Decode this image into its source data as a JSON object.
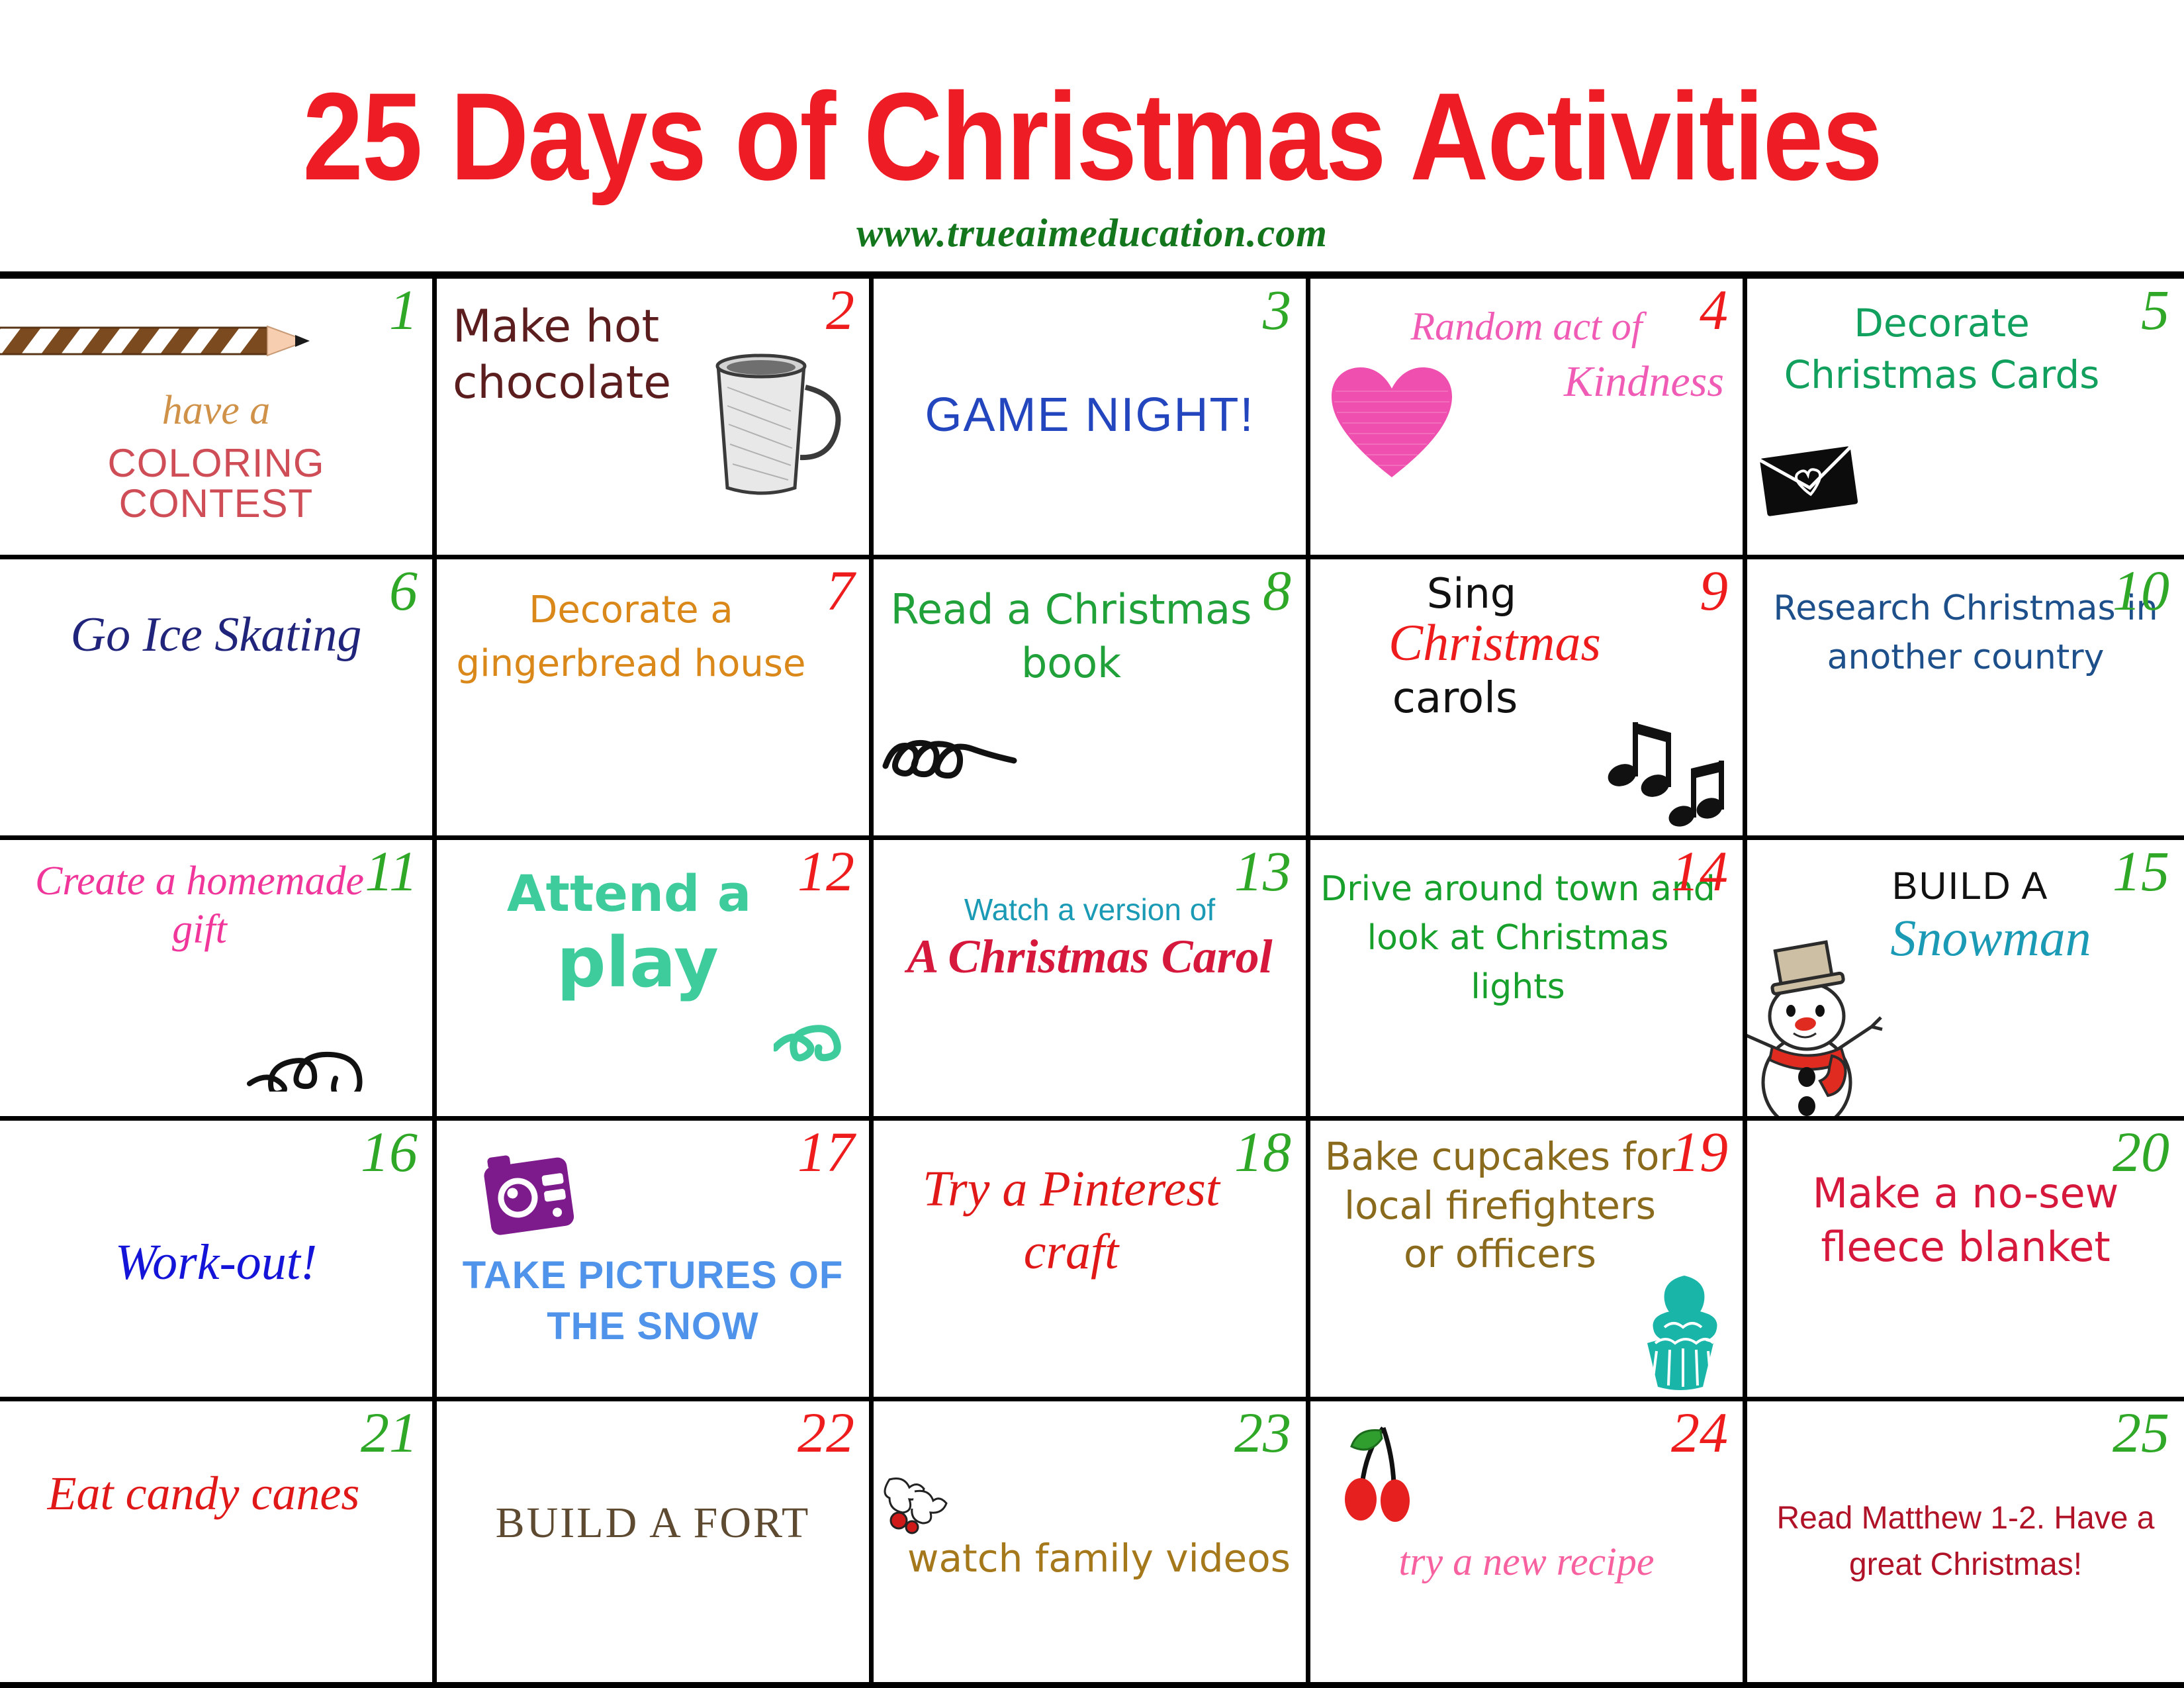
{
  "header": {
    "title": "25 Days of Christmas Activities",
    "website": "www.trueaimeducation.com"
  },
  "colors": {
    "title_red": "#ee1c25",
    "website_green": "#13761c",
    "number_green": "#2fa828",
    "number_red": "#ee1c1c",
    "grid_line": "#000000",
    "background": "#ffffff"
  },
  "grid": {
    "columns": 5,
    "rows": 5
  },
  "days": [
    {
      "num": "1",
      "num_color": "green",
      "lines": [
        "have a",
        "COLORING CONTEST"
      ],
      "icons": [
        "pencil-icon"
      ]
    },
    {
      "num": "2",
      "num_color": "red",
      "lines": [
        "Make hot chocolate"
      ],
      "icons": [
        "mug-icon"
      ]
    },
    {
      "num": "3",
      "num_color": "green",
      "lines": [
        "GAME NIGHT!"
      ],
      "icons": []
    },
    {
      "num": "4",
      "num_color": "red",
      "lines": [
        "Random act of",
        "Kindness"
      ],
      "icons": [
        "heart-icon"
      ]
    },
    {
      "num": "5",
      "num_color": "green",
      "lines": [
        "Decorate Christmas Cards"
      ],
      "icons": [
        "envelope-icon"
      ]
    },
    {
      "num": "6",
      "num_color": "green",
      "lines": [
        "Go Ice Skating"
      ],
      "icons": []
    },
    {
      "num": "7",
      "num_color": "red",
      "lines": [
        "Decorate a gingerbread house"
      ],
      "icons": []
    },
    {
      "num": "8",
      "num_color": "green",
      "lines": [
        "Read a Christmas book"
      ],
      "icons": [
        "swirl-flourish-icon"
      ]
    },
    {
      "num": "9",
      "num_color": "red",
      "lines": [
        "Sing",
        "Christmas",
        "carols"
      ],
      "icons": [
        "music-notes-icon"
      ]
    },
    {
      "num": "10",
      "num_color": "green",
      "lines": [
        "Research Christmas in another country"
      ],
      "icons": []
    },
    {
      "num": "11",
      "num_color": "green",
      "lines": [
        "Create a homemade gift"
      ],
      "icons": [
        "swirl-flourish-icon"
      ]
    },
    {
      "num": "12",
      "num_color": "red",
      "lines": [
        "Attend a",
        "play"
      ],
      "icons": [
        "swirl-flourish-icon"
      ]
    },
    {
      "num": "13",
      "num_color": "green",
      "lines": [
        "Watch a version of",
        "A Christmas Carol"
      ],
      "icons": []
    },
    {
      "num": "14",
      "num_color": "red",
      "lines": [
        "Drive around town and look at Christmas lights"
      ],
      "icons": [
        "snowman-icon"
      ]
    },
    {
      "num": "15",
      "num_color": "green",
      "lines": [
        "BUILD A",
        "Snowman"
      ],
      "icons": []
    },
    {
      "num": "16",
      "num_color": "green",
      "lines": [
        "Work-out!"
      ],
      "icons": []
    },
    {
      "num": "17",
      "num_color": "red",
      "lines": [
        "TAKE PICTURES OF THE SNOW"
      ],
      "icons": [
        "camera-icon"
      ]
    },
    {
      "num": "18",
      "num_color": "green",
      "lines": [
        "Try a Pinterest craft"
      ],
      "icons": []
    },
    {
      "num": "19",
      "num_color": "red",
      "lines": [
        "Bake cupcakes for local firefighters or officers"
      ],
      "icons": [
        "cupcake-icon"
      ]
    },
    {
      "num": "20",
      "num_color": "green",
      "lines": [
        "Make a no-sew fleece blanket"
      ],
      "icons": []
    },
    {
      "num": "21",
      "num_color": "green",
      "lines": [
        "Eat candy canes"
      ],
      "icons": []
    },
    {
      "num": "22",
      "num_color": "red",
      "lines": [
        "BUILD A FORT"
      ],
      "icons": []
    },
    {
      "num": "23",
      "num_color": "green",
      "lines": [
        "watch family videos"
      ],
      "icons": [
        "holly-icon"
      ]
    },
    {
      "num": "24",
      "num_color": "red",
      "lines": [
        "try a new recipe"
      ],
      "icons": [
        "cherries-icon"
      ]
    },
    {
      "num": "25",
      "num_color": "green",
      "lines": [
        "Read Matthew 1-2. Have a great Christmas!"
      ],
      "icons": []
    }
  ],
  "cell_text": {
    "d1_l1": "have a",
    "d1_l2": "COLORING CONTEST",
    "d2_l1": "Make hot chocolate",
    "d3_l1": "GAME NIGHT!",
    "d4_l1": "Random act of",
    "d4_l2": "Kindness",
    "d5_l1": "Decorate Christmas Cards",
    "d6_l1": "Go Ice Skating",
    "d7_l1": "Decorate a gingerbread house",
    "d8_l1": "Read a Christmas book",
    "d9_l1": "Sing",
    "d9_l2": "Christmas",
    "d9_l3": "carols",
    "d10_l1": "Research Christmas in another country",
    "d11_l1": "Create a homemade gift",
    "d12_l1": "Attend a",
    "d12_l2": "play",
    "d13_l1": "Watch a version of",
    "d13_l2": "A Christmas Carol",
    "d14_l1": "Drive around town and look at Christmas lights",
    "d15_l1": "BUILD A",
    "d15_l2": "Snowman",
    "d16_l1": "Work-out!",
    "d17_l1": "TAKE PICTURES OF THE SNOW",
    "d18_l1": "Try a Pinterest craft",
    "d19_l1": "Bake cupcakes for local firefighters or officers",
    "d20_l1": "Make a no-sew fleece blanket",
    "d21_l1": "Eat candy canes",
    "d22_l1": "BUILD A FORT",
    "d23_l1": "watch family videos",
    "d24_l1": "try a new recipe",
    "d25_l1": "Read Matthew 1-2. Have a great Christmas!"
  },
  "day_numbers": {
    "n1": "1",
    "n2": "2",
    "n3": "3",
    "n4": "4",
    "n5": "5",
    "n6": "6",
    "n7": "7",
    "n8": "8",
    "n9": "9",
    "n10": "10",
    "n11": "11",
    "n12": "12",
    "n13": "13",
    "n14": "14",
    "n15": "15",
    "n16": "16",
    "n17": "17",
    "n18": "18",
    "n19": "19",
    "n20": "20",
    "n21": "21",
    "n22": "22",
    "n23": "23",
    "n24": "24",
    "n25": "25"
  }
}
